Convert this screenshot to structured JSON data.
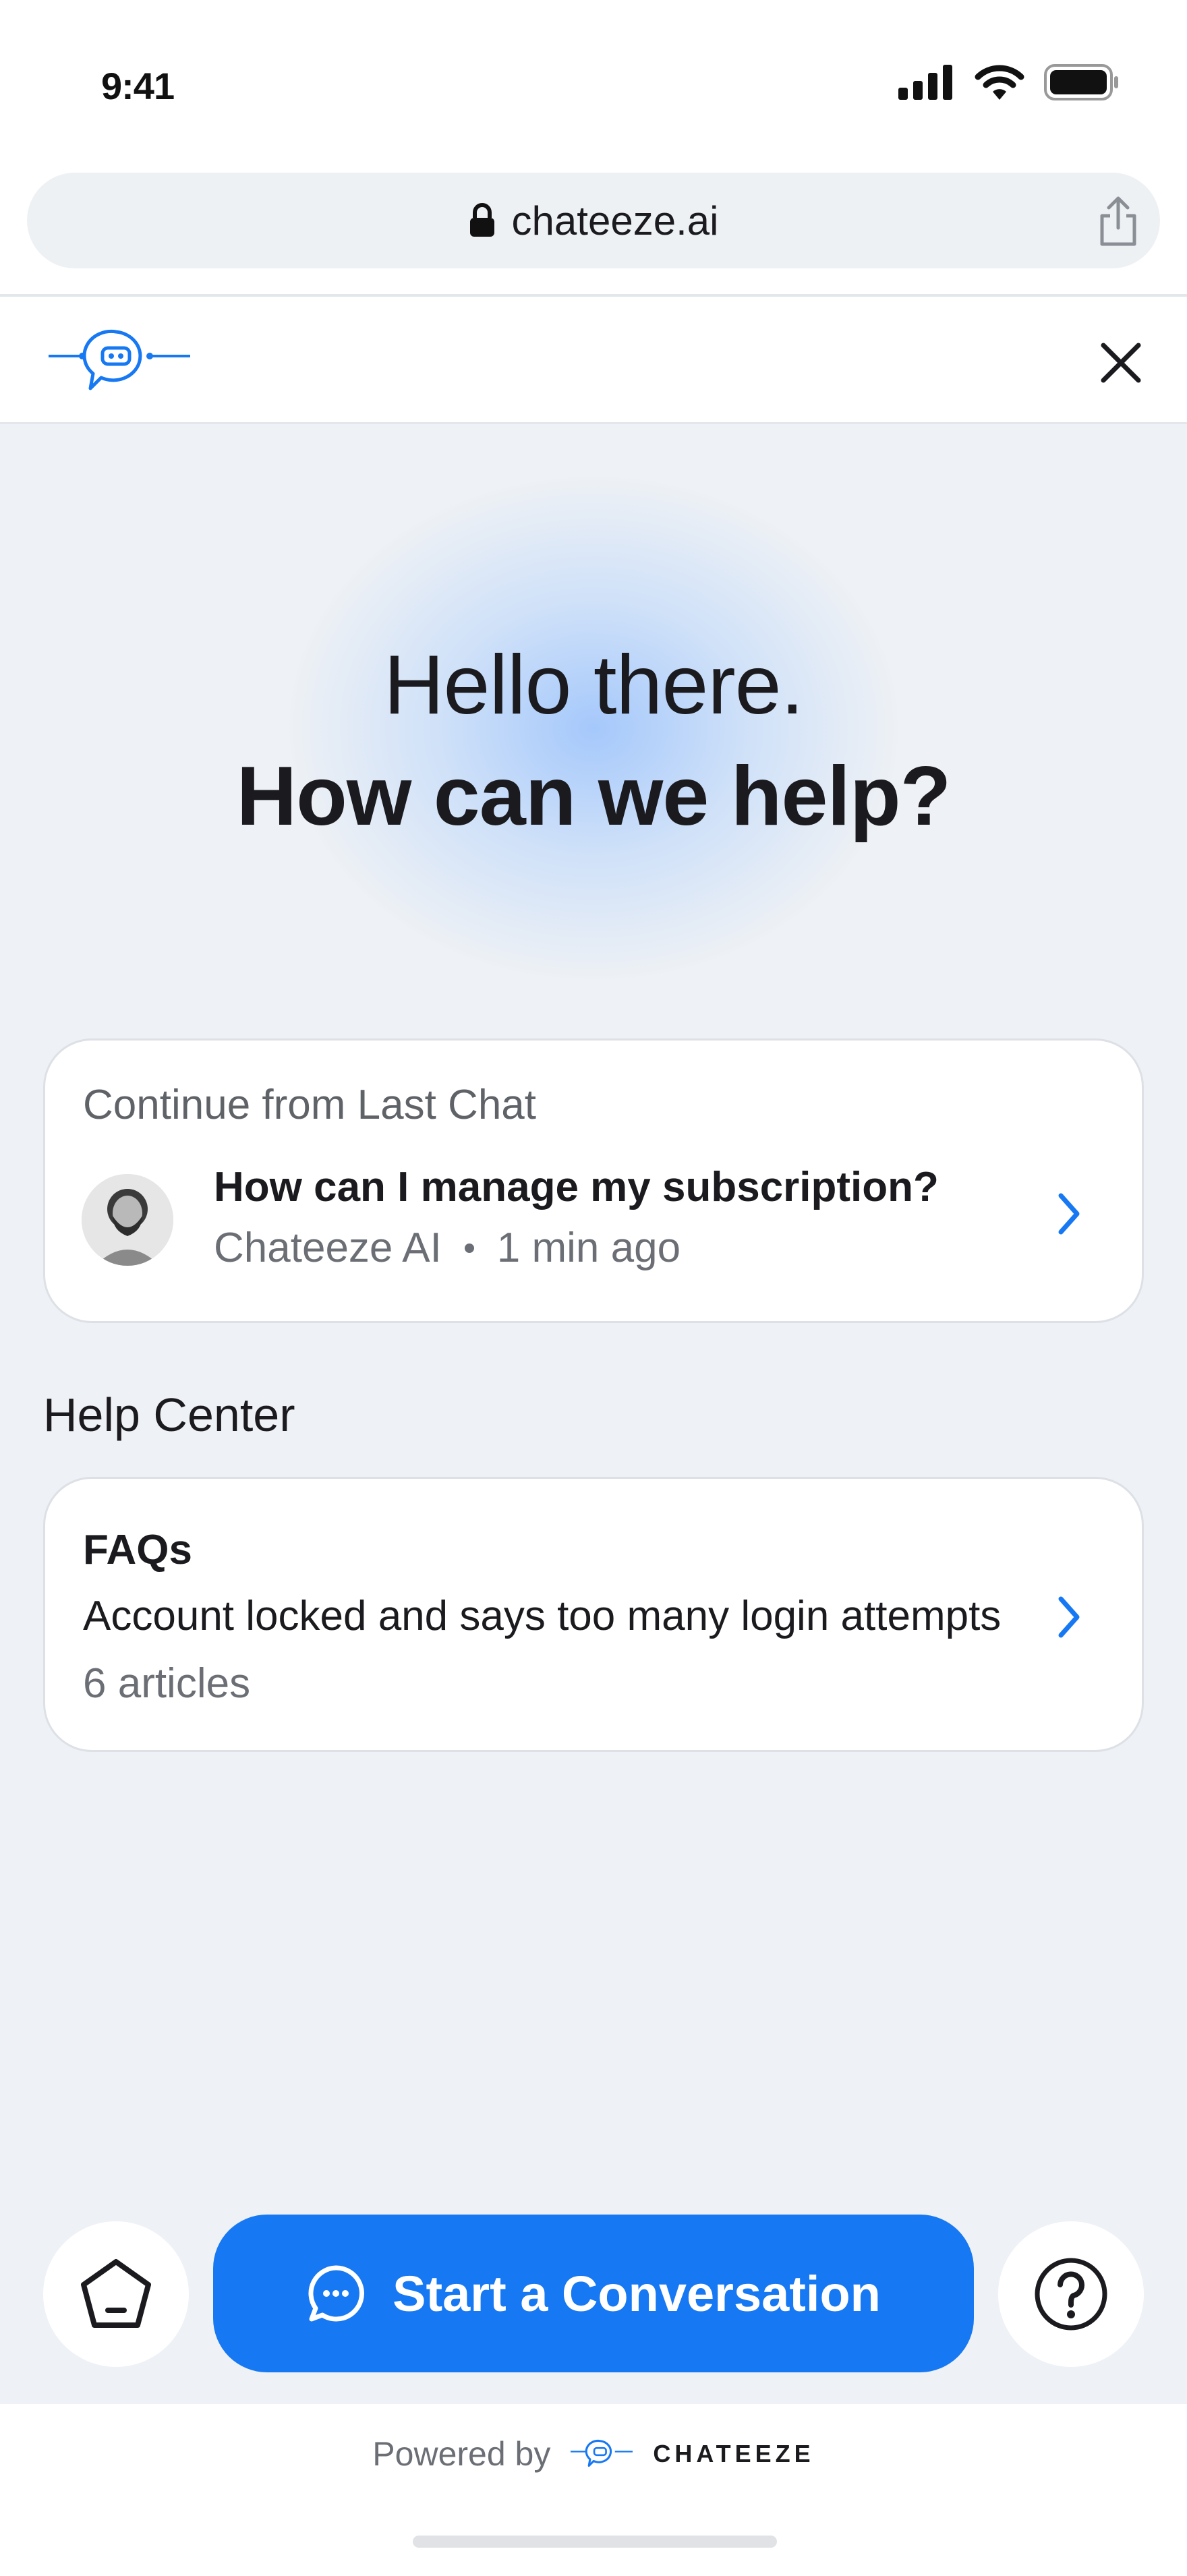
{
  "status_bar": {
    "time": "9:41"
  },
  "browser": {
    "url": "chateeze.ai"
  },
  "hero": {
    "line1": "Hello there.",
    "line2": "How can we help?"
  },
  "last_chat": {
    "heading": "Continue from Last Chat",
    "question": "How can I manage my subscription?",
    "sender": "Chateeze AI",
    "time_ago": "1 min ago"
  },
  "help_center": {
    "heading": "Help Center",
    "faq_title": "FAQs",
    "faq_item": "Account locked and says too many login attempts",
    "faq_count": "6 articles"
  },
  "actions": {
    "start_label": "Start a Conversation"
  },
  "footer": {
    "powered_by": "Powered by",
    "brand": "CHATEEZE"
  },
  "colors": {
    "accent": "#1678f2",
    "background": "#eef1f5",
    "text": "#1b1b1f",
    "muted": "#6b6f75"
  },
  "icons": {
    "status": [
      "signal-icon",
      "wifi-icon",
      "battery-icon"
    ],
    "browser": [
      "lock-icon",
      "share-icon"
    ],
    "header": [
      "chateeze-logo",
      "close-icon"
    ],
    "nav": [
      "home-icon",
      "chat-bubble-icon",
      "question-icon",
      "chevron-right-icon"
    ]
  }
}
